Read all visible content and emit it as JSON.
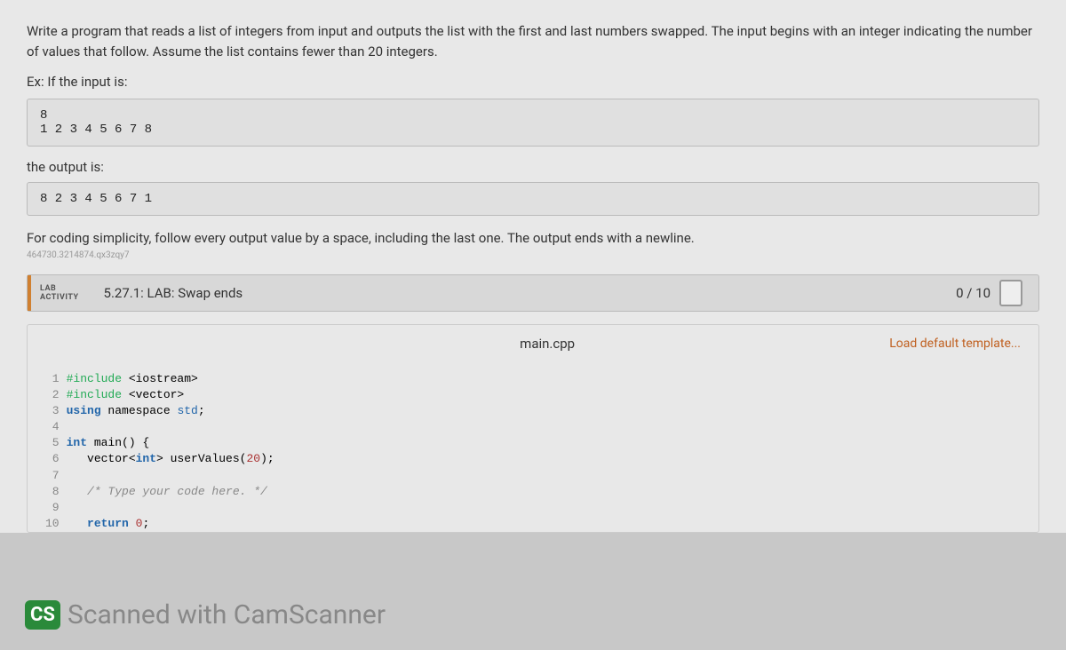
{
  "problem": {
    "description": "Write a program that reads a list of integers from input and outputs the list with the first and last numbers swapped. The input begins with an integer indicating the number of values that follow. Assume the list contains fewer than 20 integers.",
    "example_label": "Ex: If the input is:",
    "input_example": "8\n1 2 3 4 5 6 7 8",
    "output_label": "the output is:",
    "output_example": "8 2 3 4 5 6 7 1",
    "followup": "For coding simplicity, follow every output value by a space, including the last one. The output ends with a newline.",
    "hash": "464730.3214874.qx3zqy7"
  },
  "lab": {
    "badge_line1": "LAB",
    "badge_line2": "ACTIVITY",
    "title": "5.27.1: LAB: Swap ends",
    "score": "0 / 10"
  },
  "editor": {
    "filename": "main.cpp",
    "load_template": "Load default template...",
    "gutter": "1\n2\n3\n4\n5\n6\n7\n8\n9\n10",
    "lines": {
      "l1a": "#include ",
      "l1b": "<iostream>",
      "l2a": "#include ",
      "l2b": "<vector>",
      "l3a": "using",
      "l3b": " namespace ",
      "l3c": "std",
      "l3d": ";",
      "l4": "",
      "l5a": "int",
      "l5b": " main() {",
      "l6a": "   vector<",
      "l6b": "int",
      "l6c": "> userValues(",
      "l6d": "20",
      "l6e": ");",
      "l7": "",
      "l8": "   /* Type your code here. */",
      "l9": "",
      "l10a": "   ",
      "l10b": "return",
      "l10c": " ",
      "l10d": "0",
      "l10e": ";"
    }
  },
  "watermark": {
    "badge": "CS",
    "text": "Scanned with CamScanner"
  }
}
